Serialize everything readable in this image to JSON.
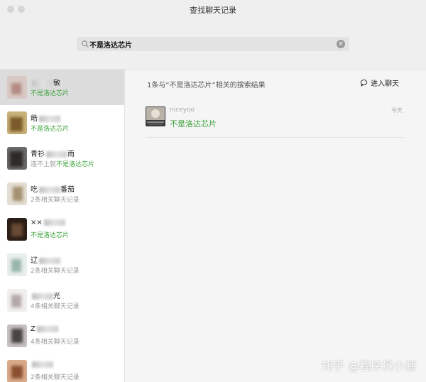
{
  "window": {
    "title": "查找聊天记录"
  },
  "search": {
    "value": "不是洛达芯片"
  },
  "sidebar": {
    "contacts": [
      {
        "name": "",
        "name_tail": "敏",
        "sub_prefix": "",
        "sub_highlight": "不是洛达芯片",
        "selected": true
      },
      {
        "name": "皓",
        "name_tail": "",
        "sub_prefix": "",
        "sub_highlight": "不是洛达芯片",
        "selected": false
      },
      {
        "name": "青衫",
        "name_tail": "雨",
        "sub_prefix": "连不上就",
        "sub_highlight": "不是洛达芯片",
        "selected": false
      },
      {
        "name": "吃",
        "name_tail": "番茄",
        "sub_prefix": "2条相关聊天记录",
        "sub_highlight": "",
        "selected": false
      },
      {
        "name": "××",
        "name_tail": "",
        "sub_prefix": "",
        "sub_highlight": "不是洛达芯片",
        "selected": false
      },
      {
        "name": "辽",
        "name_tail": "",
        "sub_prefix": "2条相关聊天记录",
        "sub_highlight": "",
        "selected": false
      },
      {
        "name": "",
        "name_tail": "光",
        "sub_prefix": "4条相关聊天记录",
        "sub_highlight": "",
        "selected": false
      },
      {
        "name": "Z",
        "name_tail": "",
        "sub_prefix": "4条相关聊天记录",
        "sub_highlight": "",
        "selected": false
      },
      {
        "name": "",
        "name_tail": "",
        "sub_prefix": "2条相关聊天记录",
        "sub_highlight": "",
        "selected": false
      }
    ]
  },
  "main": {
    "result_count": "1条与“不是洛达芯片”相关的搜索结果",
    "enter_chat": "进入聊天",
    "results": [
      {
        "name": "niceyoo",
        "message": "不是洛达芯片",
        "time": "今天"
      }
    ]
  },
  "watermark": "知乎 @程序员小源"
}
